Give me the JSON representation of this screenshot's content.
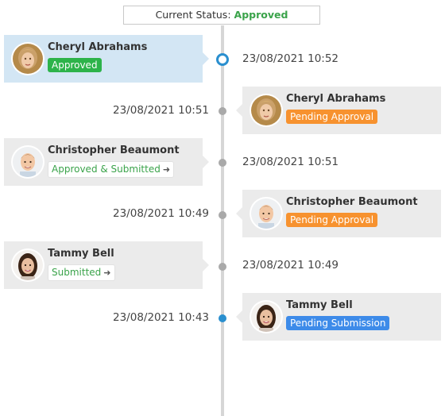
{
  "header": {
    "status_label": "Current Status:",
    "status_value": "Approved"
  },
  "colors": {
    "accent": "#2a8fcf",
    "approved": "#2db34a",
    "pending": "#f7922f",
    "pending_submission": "#3d8be9"
  },
  "events": [
    {
      "name": "Cheryl Abrahams",
      "badge": "Approved",
      "time": "23/08/2021 10:52"
    },
    {
      "name": "Cheryl Abrahams",
      "badge": "Pending Approval",
      "time": "23/08/2021 10:51"
    },
    {
      "name": "Christopher Beaumont",
      "badge": "Approved & Submitted",
      "time": "23/08/2021 10:51"
    },
    {
      "name": "Christopher Beaumont",
      "badge": "Pending Approval",
      "time": "23/08/2021 10:49"
    },
    {
      "name": "Tammy Bell",
      "badge": "Submitted",
      "time": "23/08/2021 10:49"
    },
    {
      "name": "Tammy Bell",
      "badge": "Pending Submission",
      "time": "23/08/2021 10:43"
    }
  ],
  "icons": {
    "arrow": "arrow-right-icon",
    "avatar": "user-avatar"
  }
}
